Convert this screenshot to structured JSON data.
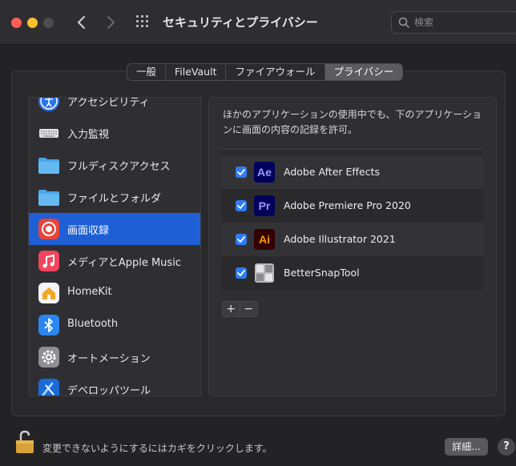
{
  "window": {
    "title": "セキュリティとプライバシー",
    "search_placeholder": "検索"
  },
  "tabs": [
    {
      "label": "一般",
      "active": false
    },
    {
      "label": "FileVault",
      "active": false
    },
    {
      "label": "ファイアウォール",
      "active": false
    },
    {
      "label": "プライバシー",
      "active": true
    }
  ],
  "sidebar": {
    "items": [
      {
        "label": "アクセシビリティ",
        "icon": "accessibility-icon"
      },
      {
        "label": "入力監視",
        "icon": "keyboard-icon"
      },
      {
        "label": "フルディスクアクセス",
        "icon": "folder-icon"
      },
      {
        "label": "ファイルとフォルダ",
        "icon": "folder-icon"
      },
      {
        "label": "画面収録",
        "icon": "screen-record-icon",
        "selected": true
      },
      {
        "label": "メディアとApple Music",
        "icon": "music-icon"
      },
      {
        "label": "HomeKit",
        "icon": "home-icon"
      },
      {
        "label": "Bluetooth",
        "icon": "bluetooth-icon"
      },
      {
        "label": "オートメーション",
        "icon": "gear-icon"
      },
      {
        "label": "デベロッパツール",
        "icon": "xcode-icon"
      }
    ]
  },
  "content": {
    "description": "ほかのアプリケーションの使用中でも、下のアプリケーションに画面の内容の記録を許可。",
    "apps": [
      {
        "name": "Adobe After Effects",
        "icon_text": "Ae",
        "checked": true,
        "icon_fg": "#9999ff",
        "icon_bg": "#00005b"
      },
      {
        "name": "Adobe Premiere Pro 2020",
        "icon_text": "Pr",
        "checked": true,
        "icon_fg": "#9999ff",
        "icon_bg": "#00005b"
      },
      {
        "name": "Adobe Illustrator 2021",
        "icon_text": "Ai",
        "checked": true,
        "icon_fg": "#ff9a00",
        "icon_bg": "#330000"
      },
      {
        "name": "BetterSnapTool",
        "icon_text": "",
        "checked": true
      }
    ],
    "add_label": "+",
    "remove_label": "−"
  },
  "footer": {
    "lock_text": "変更できないようにするにはカギをクリックします。",
    "details_label": "詳細...",
    "help_label": "?"
  },
  "colors": {
    "accent": "#1f5fd6",
    "checkbox": "#2f7cf6"
  }
}
